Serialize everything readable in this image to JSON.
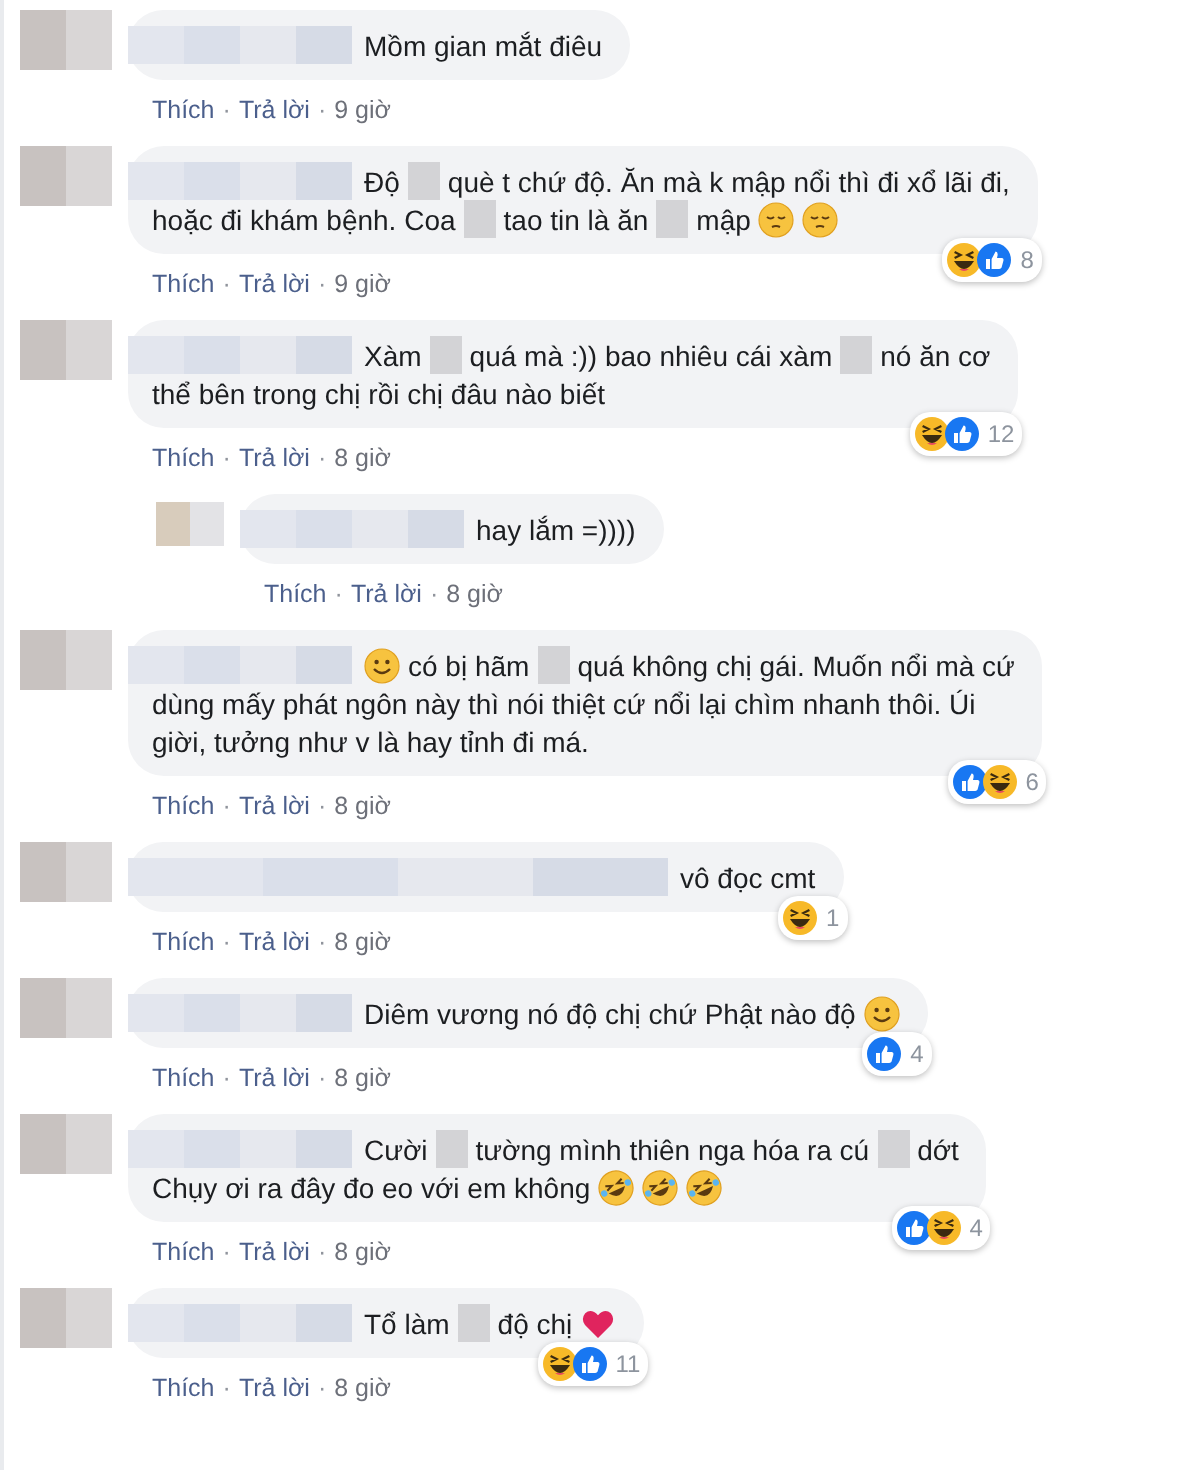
{
  "comments": [
    {
      "lines": [
        [
          {
            "kind": "name"
          },
          {
            "kind": "text",
            "text": "Mồm gian mắt điêu"
          }
        ]
      ],
      "actions": [
        {
          "kind": "link",
          "text": "Thích"
        },
        {
          "kind": "dot",
          "text": "·"
        },
        {
          "kind": "link",
          "text": "Trả lời"
        },
        {
          "kind": "dot",
          "text": "·"
        },
        {
          "kind": "time",
          "text": "9 giờ"
        }
      ]
    },
    {
      "lines": [
        [
          {
            "kind": "name"
          },
          {
            "kind": "text",
            "text": "Độ"
          },
          {
            "kind": "blur"
          },
          {
            "kind": "text",
            "text": "què t chứ độ. Ăn mà k mập nổi thì đi xổ lãi đi,"
          }
        ],
        [
          {
            "kind": "text",
            "text": "hoặc đi khám bệnh. Coa"
          },
          {
            "kind": "blur"
          },
          {
            "kind": "text",
            "text": "tao tin là ăn"
          },
          {
            "kind": "blur"
          },
          {
            "kind": "text",
            "text": "mập"
          },
          {
            "kind": "pensive"
          },
          {
            "kind": "pensive"
          }
        ]
      ],
      "actions": [
        {
          "kind": "link",
          "text": "Thích"
        },
        {
          "kind": "dot",
          "text": "·"
        },
        {
          "kind": "link",
          "text": "Trả lời"
        },
        {
          "kind": "dot",
          "text": "·"
        },
        {
          "kind": "time",
          "text": "9 giờ"
        }
      ],
      "reactions": [
        {
          "kind": "haha"
        },
        {
          "kind": "like"
        }
      ],
      "count": "8"
    },
    {
      "lines": [
        [
          {
            "kind": "name"
          },
          {
            "kind": "text",
            "text": "Xàm"
          },
          {
            "kind": "blur"
          },
          {
            "kind": "text",
            "text": "quá mà :)) bao nhiêu cái xàm"
          },
          {
            "kind": "blur"
          },
          {
            "kind": "text",
            "text": "nó ăn cơ"
          }
        ],
        [
          {
            "kind": "text",
            "text": "thể bên trong chị rồi chị đâu nào biết"
          }
        ]
      ],
      "actions": [
        {
          "kind": "link",
          "text": "Thích"
        },
        {
          "kind": "dot",
          "text": "·"
        },
        {
          "kind": "link",
          "text": "Trả lời"
        },
        {
          "kind": "dot",
          "text": "·"
        },
        {
          "kind": "time",
          "text": "8 giờ"
        }
      ],
      "reactions": [
        {
          "kind": "haha"
        },
        {
          "kind": "like"
        }
      ],
      "count": "12",
      "replies": [
        {
          "lines": [
            [
              {
                "kind": "name"
              },
              {
                "kind": "text",
                "text": "hay lắm =))))"
              }
            ]
          ],
          "actions": [
            {
              "kind": "link",
              "text": "Thích"
            },
            {
              "kind": "dot",
              "text": "·"
            },
            {
              "kind": "link",
              "text": "Trả lời"
            },
            {
              "kind": "dot",
              "text": "·"
            },
            {
              "kind": "time",
              "text": "8 giờ"
            }
          ]
        }
      ]
    },
    {
      "lines": [
        [
          {
            "kind": "name"
          },
          {
            "kind": "smile"
          },
          {
            "kind": "text",
            "text": "có bị hãm"
          },
          {
            "kind": "blur"
          },
          {
            "kind": "text",
            "text": "quá không chị gái. Muốn nổi mà cứ"
          }
        ],
        [
          {
            "kind": "text",
            "text": "dùng mấy phát ngôn này thì nói thiệt cứ nổi lại chìm nhanh thôi. Úi"
          }
        ],
        [
          {
            "kind": "text",
            "text": "giời, tưởng như v là hay tỉnh đi má."
          }
        ]
      ],
      "actions": [
        {
          "kind": "link",
          "text": "Thích"
        },
        {
          "kind": "dot",
          "text": "·"
        },
        {
          "kind": "link",
          "text": "Trả lời"
        },
        {
          "kind": "dot",
          "text": "·"
        },
        {
          "kind": "time",
          "text": "8 giờ"
        }
      ],
      "reactions": [
        {
          "kind": "like"
        },
        {
          "kind": "haha"
        }
      ],
      "count": "6"
    },
    {
      "lines": [
        [
          {
            "kind": "longname"
          },
          {
            "kind": "text",
            "text": "vô đọc cmt"
          }
        ]
      ],
      "actions": [
        {
          "kind": "link",
          "text": "Thích"
        },
        {
          "kind": "dot",
          "text": "·"
        },
        {
          "kind": "link",
          "text": "Trả lời"
        },
        {
          "kind": "dot",
          "text": "·"
        },
        {
          "kind": "time",
          "text": "8 giờ"
        }
      ],
      "reactions": [
        {
          "kind": "haha"
        }
      ],
      "count": "1"
    },
    {
      "lines": [
        [
          {
            "kind": "name"
          },
          {
            "kind": "text",
            "text": "Diêm vương nó độ chị chứ Phật nào độ"
          },
          {
            "kind": "smile"
          }
        ]
      ],
      "actions": [
        {
          "kind": "link",
          "text": "Thích"
        },
        {
          "kind": "dot",
          "text": "·"
        },
        {
          "kind": "link",
          "text": "Trả lời"
        },
        {
          "kind": "dot",
          "text": "·"
        },
        {
          "kind": "time",
          "text": "8 giờ"
        }
      ],
      "reactions": [
        {
          "kind": "like"
        }
      ],
      "count": "4"
    },
    {
      "lines": [
        [
          {
            "kind": "name"
          },
          {
            "kind": "text",
            "text": "Cười"
          },
          {
            "kind": "blur"
          },
          {
            "kind": "text",
            "text": "tường mình thiên nga hóa ra cú"
          },
          {
            "kind": "blur"
          },
          {
            "kind": "text",
            "text": "dớt"
          }
        ],
        [
          {
            "kind": "text",
            "text": "Chụy ơi ra đây đo eo với em không"
          },
          {
            "kind": "rofl"
          },
          {
            "kind": "rofl"
          },
          {
            "kind": "rofl"
          }
        ]
      ],
      "actions": [
        {
          "kind": "link",
          "text": "Thích"
        },
        {
          "kind": "dot",
          "text": "·"
        },
        {
          "kind": "link",
          "text": "Trả lời"
        },
        {
          "kind": "dot",
          "text": "·"
        },
        {
          "kind": "time",
          "text": "8 giờ"
        }
      ],
      "reactions": [
        {
          "kind": "like"
        },
        {
          "kind": "haha"
        }
      ],
      "count": "4"
    },
    {
      "lines": [
        [
          {
            "kind": "name"
          },
          {
            "kind": "text",
            "text": "Tổ làm"
          },
          {
            "kind": "blur"
          },
          {
            "kind": "text",
            "text": "độ chị"
          },
          {
            "kind": "heart"
          }
        ]
      ],
      "actions": [
        {
          "kind": "link",
          "text": "Thích"
        },
        {
          "kind": "dot",
          "text": "·"
        },
        {
          "kind": "link",
          "text": "Trả lời"
        },
        {
          "kind": "dot",
          "text": "·"
        },
        {
          "kind": "time",
          "text": "8 giờ"
        }
      ],
      "reactions": [
        {
          "kind": "haha"
        },
        {
          "kind": "like"
        }
      ],
      "count": "11"
    }
  ]
}
